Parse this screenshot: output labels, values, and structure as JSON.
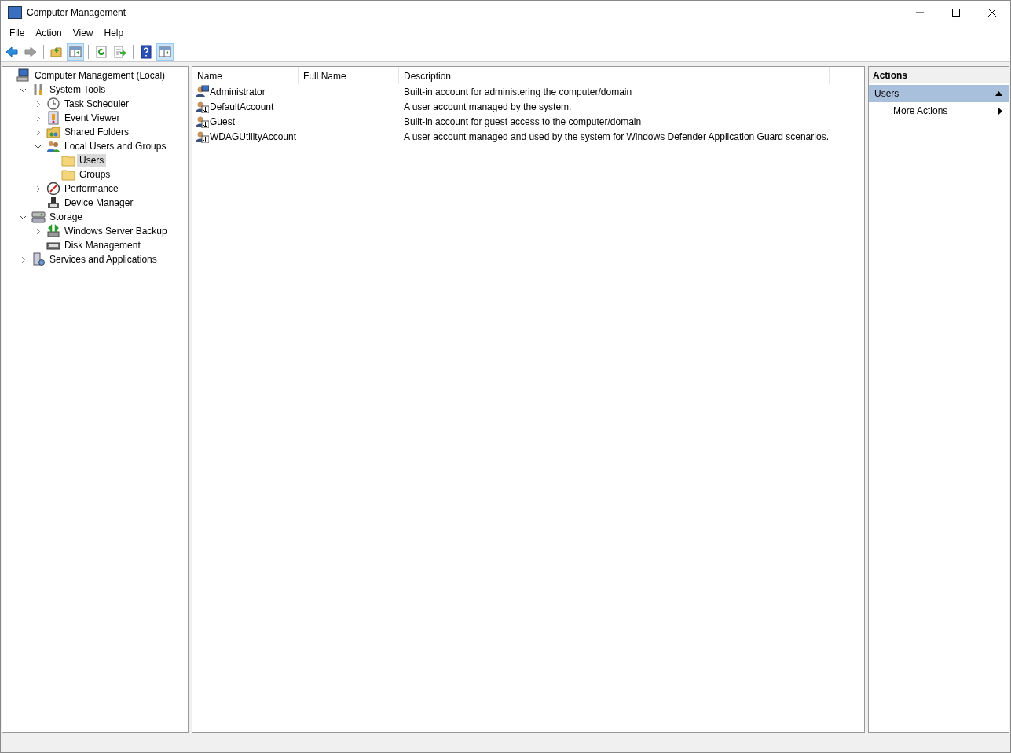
{
  "window": {
    "title": "Computer Management"
  },
  "menu": [
    "File",
    "Action",
    "View",
    "Help"
  ],
  "toolbar": [
    {
      "kind": "back",
      "pressed": false,
      "disabled": false
    },
    {
      "kind": "forward",
      "pressed": false,
      "disabled": true
    },
    {
      "kind": "sep"
    },
    {
      "kind": "up",
      "pressed": false,
      "disabled": false
    },
    {
      "kind": "panel",
      "pressed": true,
      "disabled": false
    },
    {
      "kind": "sep"
    },
    {
      "kind": "refresh",
      "pressed": false,
      "disabled": false
    },
    {
      "kind": "export",
      "pressed": false,
      "disabled": false
    },
    {
      "kind": "sep"
    },
    {
      "kind": "help",
      "pressed": false,
      "disabled": false
    },
    {
      "kind": "panel",
      "pressed": true,
      "disabled": false
    }
  ],
  "tree": [
    {
      "label": "Computer Management (Local)",
      "kind": "computer",
      "selected": false,
      "children": [
        {
          "label": "System Tools",
          "kind": "tools",
          "expanded": true,
          "selected": false,
          "children": [
            {
              "label": "Task Scheduler",
              "kind": "clock",
              "expanded": false,
              "selected": false
            },
            {
              "label": "Event Viewer",
              "kind": "log",
              "expanded": false,
              "selected": false
            },
            {
              "label": "Shared Folders",
              "kind": "share",
              "expanded": false,
              "selected": false
            },
            {
              "label": "Local Users and Groups",
              "kind": "users",
              "expanded": true,
              "selected": false,
              "children": [
                {
                  "label": "Users",
                  "kind": "folder",
                  "selected": true
                },
                {
                  "label": "Groups",
                  "kind": "folder",
                  "selected": false
                }
              ]
            },
            {
              "label": "Performance",
              "kind": "gauge",
              "expanded": false,
              "selected": false
            },
            {
              "label": "Device Manager",
              "kind": "device",
              "selected": false
            }
          ]
        },
        {
          "label": "Storage",
          "kind": "storage",
          "expanded": true,
          "selected": false,
          "children": [
            {
              "label": "Windows Server Backup",
              "kind": "backup",
              "expanded": false,
              "selected": false
            },
            {
              "label": "Disk Management",
              "kind": "disk",
              "selected": false
            }
          ]
        },
        {
          "label": "Services and Applications",
          "kind": "services",
          "expanded": false,
          "selected": false
        }
      ]
    }
  ],
  "table": {
    "columns": [
      "Name",
      "Full Name",
      "Description"
    ],
    "rows": [
      {
        "kind": "admin",
        "cells": [
          "Administrator",
          "",
          "Built-in account for administering the computer/domain"
        ]
      },
      {
        "kind": "user",
        "cells": [
          "DefaultAccount",
          "",
          "A user account managed by the system."
        ]
      },
      {
        "kind": "user",
        "cells": [
          "Guest",
          "",
          "Built-in account for guest access to the computer/domain"
        ]
      },
      {
        "kind": "user",
        "cells": [
          "WDAGUtilityAccount",
          "",
          "A user account managed and used by the system for Windows Defender Application Guard scenarios."
        ]
      }
    ]
  },
  "actions": {
    "title": "Actions",
    "sections": [
      {
        "title": "Users",
        "expanded": true,
        "items": [
          {
            "label": "More Actions",
            "submenu": true
          }
        ]
      }
    ]
  }
}
